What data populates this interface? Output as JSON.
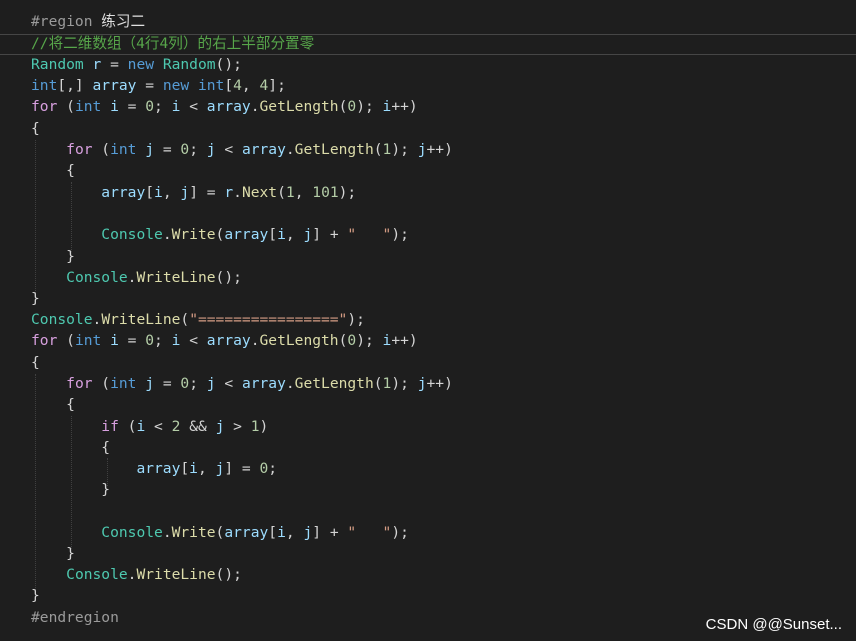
{
  "editor": {
    "language": "csharp",
    "theme_colors": {
      "background": "#1e1e1e",
      "keyword": "#569cd6",
      "control_keyword": "#d8a0df",
      "type": "#4ec9b0",
      "method": "#dcdcaa",
      "number": "#b5cea8",
      "string": "#d69d85",
      "comment": "#57a64a",
      "variable": "#9cdcfe",
      "preprocessor": "#9b9b9b",
      "text": "#d4d4d4"
    },
    "lines": [
      [
        {
          "t": "#region ",
          "c": "pre"
        },
        {
          "t": "练习二",
          "c": "region-name"
        }
      ],
      [
        {
          "t": "//将二维数组（4行4列）的右上半部分置零",
          "c": "cmt"
        }
      ],
      [
        {
          "t": "Random",
          "c": "type"
        },
        {
          "t": " ",
          "c": "punc"
        },
        {
          "t": "r",
          "c": "var"
        },
        {
          "t": " = ",
          "c": "punc"
        },
        {
          "t": "new",
          "c": "kw"
        },
        {
          "t": " ",
          "c": "punc"
        },
        {
          "t": "Random",
          "c": "type"
        },
        {
          "t": "();",
          "c": "punc"
        }
      ],
      [
        {
          "t": "int",
          "c": "kw"
        },
        {
          "t": "[,] ",
          "c": "punc"
        },
        {
          "t": "array",
          "c": "var"
        },
        {
          "t": " = ",
          "c": "punc"
        },
        {
          "t": "new",
          "c": "kw"
        },
        {
          "t": " ",
          "c": "punc"
        },
        {
          "t": "int",
          "c": "kw"
        },
        {
          "t": "[",
          "c": "punc"
        },
        {
          "t": "4",
          "c": "num"
        },
        {
          "t": ", ",
          "c": "punc"
        },
        {
          "t": "4",
          "c": "num"
        },
        {
          "t": "];",
          "c": "punc"
        }
      ],
      [
        {
          "t": "for",
          "c": "ctrl"
        },
        {
          "t": " (",
          "c": "punc"
        },
        {
          "t": "int",
          "c": "kw"
        },
        {
          "t": " ",
          "c": "punc"
        },
        {
          "t": "i",
          "c": "var"
        },
        {
          "t": " = ",
          "c": "punc"
        },
        {
          "t": "0",
          "c": "num"
        },
        {
          "t": "; ",
          "c": "punc"
        },
        {
          "t": "i",
          "c": "var"
        },
        {
          "t": " < ",
          "c": "punc"
        },
        {
          "t": "array",
          "c": "var"
        },
        {
          "t": ".",
          "c": "punc"
        },
        {
          "t": "GetLength",
          "c": "method"
        },
        {
          "t": "(",
          "c": "punc"
        },
        {
          "t": "0",
          "c": "num"
        },
        {
          "t": "); ",
          "c": "punc"
        },
        {
          "t": "i",
          "c": "var"
        },
        {
          "t": "++)",
          "c": "punc"
        }
      ],
      [
        {
          "t": "{",
          "c": "punc"
        }
      ],
      [
        {
          "t": "    ",
          "c": "punc"
        },
        {
          "t": "for",
          "c": "ctrl"
        },
        {
          "t": " (",
          "c": "punc"
        },
        {
          "t": "int",
          "c": "kw"
        },
        {
          "t": " ",
          "c": "punc"
        },
        {
          "t": "j",
          "c": "var"
        },
        {
          "t": " = ",
          "c": "punc"
        },
        {
          "t": "0",
          "c": "num"
        },
        {
          "t": "; ",
          "c": "punc"
        },
        {
          "t": "j",
          "c": "var"
        },
        {
          "t": " < ",
          "c": "punc"
        },
        {
          "t": "array",
          "c": "var"
        },
        {
          "t": ".",
          "c": "punc"
        },
        {
          "t": "GetLength",
          "c": "method"
        },
        {
          "t": "(",
          "c": "punc"
        },
        {
          "t": "1",
          "c": "num"
        },
        {
          "t": "); ",
          "c": "punc"
        },
        {
          "t": "j",
          "c": "var"
        },
        {
          "t": "++)",
          "c": "punc"
        }
      ],
      [
        {
          "t": "    {",
          "c": "punc"
        }
      ],
      [
        {
          "t": "        ",
          "c": "punc"
        },
        {
          "t": "array",
          "c": "var"
        },
        {
          "t": "[",
          "c": "punc"
        },
        {
          "t": "i",
          "c": "var"
        },
        {
          "t": ", ",
          "c": "punc"
        },
        {
          "t": "j",
          "c": "var"
        },
        {
          "t": "] = ",
          "c": "punc"
        },
        {
          "t": "r",
          "c": "var"
        },
        {
          "t": ".",
          "c": "punc"
        },
        {
          "t": "Next",
          "c": "method"
        },
        {
          "t": "(",
          "c": "punc"
        },
        {
          "t": "1",
          "c": "num"
        },
        {
          "t": ", ",
          "c": "punc"
        },
        {
          "t": "101",
          "c": "num"
        },
        {
          "t": ");",
          "c": "punc"
        }
      ],
      [],
      [
        {
          "t": "        ",
          "c": "punc"
        },
        {
          "t": "Console",
          "c": "type"
        },
        {
          "t": ".",
          "c": "punc"
        },
        {
          "t": "Write",
          "c": "method"
        },
        {
          "t": "(",
          "c": "punc"
        },
        {
          "t": "array",
          "c": "var"
        },
        {
          "t": "[",
          "c": "punc"
        },
        {
          "t": "i",
          "c": "var"
        },
        {
          "t": ", ",
          "c": "punc"
        },
        {
          "t": "j",
          "c": "var"
        },
        {
          "t": "] + ",
          "c": "punc"
        },
        {
          "t": "\"   \"",
          "c": "str"
        },
        {
          "t": ");",
          "c": "punc"
        }
      ],
      [
        {
          "t": "    }",
          "c": "punc"
        }
      ],
      [
        {
          "t": "    ",
          "c": "punc"
        },
        {
          "t": "Console",
          "c": "type"
        },
        {
          "t": ".",
          "c": "punc"
        },
        {
          "t": "WriteLine",
          "c": "method"
        },
        {
          "t": "();",
          "c": "punc"
        }
      ],
      [
        {
          "t": "}",
          "c": "punc"
        }
      ],
      [
        {
          "t": "Console",
          "c": "type"
        },
        {
          "t": ".",
          "c": "punc"
        },
        {
          "t": "WriteLine",
          "c": "method"
        },
        {
          "t": "(",
          "c": "punc"
        },
        {
          "t": "\"================\"",
          "c": "str"
        },
        {
          "t": ");",
          "c": "punc"
        }
      ],
      [
        {
          "t": "for",
          "c": "ctrl"
        },
        {
          "t": " (",
          "c": "punc"
        },
        {
          "t": "int",
          "c": "kw"
        },
        {
          "t": " ",
          "c": "punc"
        },
        {
          "t": "i",
          "c": "var"
        },
        {
          "t": " = ",
          "c": "punc"
        },
        {
          "t": "0",
          "c": "num"
        },
        {
          "t": "; ",
          "c": "punc"
        },
        {
          "t": "i",
          "c": "var"
        },
        {
          "t": " < ",
          "c": "punc"
        },
        {
          "t": "array",
          "c": "var"
        },
        {
          "t": ".",
          "c": "punc"
        },
        {
          "t": "GetLength",
          "c": "method"
        },
        {
          "t": "(",
          "c": "punc"
        },
        {
          "t": "0",
          "c": "num"
        },
        {
          "t": "); ",
          "c": "punc"
        },
        {
          "t": "i",
          "c": "var"
        },
        {
          "t": "++)",
          "c": "punc"
        }
      ],
      [
        {
          "t": "{",
          "c": "punc"
        }
      ],
      [
        {
          "t": "    ",
          "c": "punc"
        },
        {
          "t": "for",
          "c": "ctrl"
        },
        {
          "t": " (",
          "c": "punc"
        },
        {
          "t": "int",
          "c": "kw"
        },
        {
          "t": " ",
          "c": "punc"
        },
        {
          "t": "j",
          "c": "var"
        },
        {
          "t": " = ",
          "c": "punc"
        },
        {
          "t": "0",
          "c": "num"
        },
        {
          "t": "; ",
          "c": "punc"
        },
        {
          "t": "j",
          "c": "var"
        },
        {
          "t": " < ",
          "c": "punc"
        },
        {
          "t": "array",
          "c": "var"
        },
        {
          "t": ".",
          "c": "punc"
        },
        {
          "t": "GetLength",
          "c": "method"
        },
        {
          "t": "(",
          "c": "punc"
        },
        {
          "t": "1",
          "c": "num"
        },
        {
          "t": "); ",
          "c": "punc"
        },
        {
          "t": "j",
          "c": "var"
        },
        {
          "t": "++)",
          "c": "punc"
        }
      ],
      [
        {
          "t": "    {",
          "c": "punc"
        }
      ],
      [
        {
          "t": "        ",
          "c": "punc"
        },
        {
          "t": "if",
          "c": "ctrl"
        },
        {
          "t": " (",
          "c": "punc"
        },
        {
          "t": "i",
          "c": "var"
        },
        {
          "t": " < ",
          "c": "punc"
        },
        {
          "t": "2",
          "c": "num"
        },
        {
          "t": " && ",
          "c": "punc"
        },
        {
          "t": "j",
          "c": "var"
        },
        {
          "t": " > ",
          "c": "punc"
        },
        {
          "t": "1",
          "c": "num"
        },
        {
          "t": ")",
          "c": "punc"
        }
      ],
      [
        {
          "t": "        {",
          "c": "punc"
        }
      ],
      [
        {
          "t": "            ",
          "c": "punc"
        },
        {
          "t": "array",
          "c": "var"
        },
        {
          "t": "[",
          "c": "punc"
        },
        {
          "t": "i",
          "c": "var"
        },
        {
          "t": ", ",
          "c": "punc"
        },
        {
          "t": "j",
          "c": "var"
        },
        {
          "t": "] = ",
          "c": "punc"
        },
        {
          "t": "0",
          "c": "num"
        },
        {
          "t": ";",
          "c": "punc"
        }
      ],
      [
        {
          "t": "        }",
          "c": "punc"
        }
      ],
      [],
      [
        {
          "t": "        ",
          "c": "punc"
        },
        {
          "t": "Console",
          "c": "type"
        },
        {
          "t": ".",
          "c": "punc"
        },
        {
          "t": "Write",
          "c": "method"
        },
        {
          "t": "(",
          "c": "punc"
        },
        {
          "t": "array",
          "c": "var"
        },
        {
          "t": "[",
          "c": "punc"
        },
        {
          "t": "i",
          "c": "var"
        },
        {
          "t": ", ",
          "c": "punc"
        },
        {
          "t": "j",
          "c": "var"
        },
        {
          "t": "] + ",
          "c": "punc"
        },
        {
          "t": "\"   \"",
          "c": "str"
        },
        {
          "t": ");",
          "c": "punc"
        }
      ],
      [
        {
          "t": "    }",
          "c": "punc"
        }
      ],
      [
        {
          "t": "    ",
          "c": "punc"
        },
        {
          "t": "Console",
          "c": "type"
        },
        {
          "t": ".",
          "c": "punc"
        },
        {
          "t": "WriteLine",
          "c": "method"
        },
        {
          "t": "();",
          "c": "punc"
        }
      ],
      [
        {
          "t": "}",
          "c": "punc"
        }
      ],
      [
        {
          "t": "#endregion",
          "c": "pre"
        }
      ]
    ]
  },
  "watermark": {
    "text": "CSDN @@Sunset..."
  }
}
